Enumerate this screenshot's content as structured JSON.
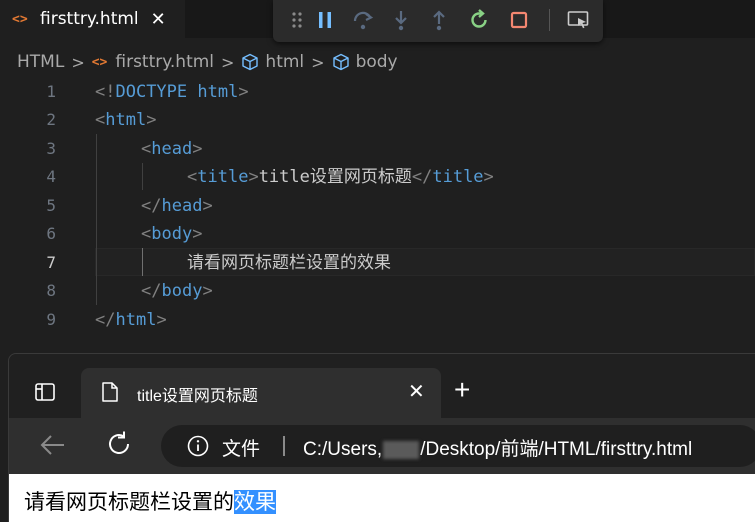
{
  "editor_tab": {
    "icon": "html-file-icon",
    "label": "firsttry.html",
    "close": "✕"
  },
  "debug_toolbar": {
    "buttons": [
      "drag-handle-icon",
      "pause-icon",
      "step-over-icon",
      "step-into-icon",
      "step-out-icon",
      "restart-icon",
      "stop-icon",
      "inspect-icon"
    ]
  },
  "breadcrumb": {
    "items": [
      "HTML",
      "firsttry.html",
      "html",
      "body"
    ],
    "separator": ">"
  },
  "code": {
    "line_numbers": [
      "1",
      "2",
      "3",
      "4",
      "5",
      "6",
      "7",
      "8",
      "9"
    ],
    "active_line": "7",
    "lines": {
      "l1": {
        "p1": "<!",
        "t1": "DOCTYPE",
        "tx": " ",
        "t2": "html",
        "p2": ">"
      },
      "l2": {
        "p1": "<",
        "t1": "html",
        "p2": ">"
      },
      "l3": {
        "p1": "<",
        "t1": "head",
        "p2": ">"
      },
      "l4": {
        "p1": "<",
        "t1": "title",
        "p2": ">",
        "tx": "title设置网页标题",
        "p3": "</",
        "t2": "title",
        "p4": ">"
      },
      "l5": {
        "p1": "</",
        "t1": "head",
        "p2": ">"
      },
      "l6": {
        "p1": "<",
        "t1": "body",
        "p2": ">"
      },
      "l7": {
        "tx": "请看网页标题栏设置的效果"
      },
      "l8": {
        "p1": "</",
        "t1": "body",
        "p2": ">"
      },
      "l9": {
        "p1": "</",
        "t1": "html",
        "p2": ">"
      }
    }
  },
  "browser": {
    "tab_title": "title设置网页标题",
    "tab_close": "✕",
    "new_tab": "+",
    "address": {
      "label": "文件",
      "url_before": "C:/Users,",
      "url_after": "/Desktop/前端/HTML/firsttry.html"
    },
    "page_text": "请看网页标题栏设置的",
    "page_text_selected": "效果",
    "selection_color": "#3390ff"
  },
  "colors": {
    "editor_bg": "#1f1f1f",
    "tag": "#569cd6",
    "punctuation": "#808080",
    "html_icon": "#e37933",
    "restart": "#89d185",
    "stop": "#f48771",
    "debug_blue": "#75beff"
  }
}
